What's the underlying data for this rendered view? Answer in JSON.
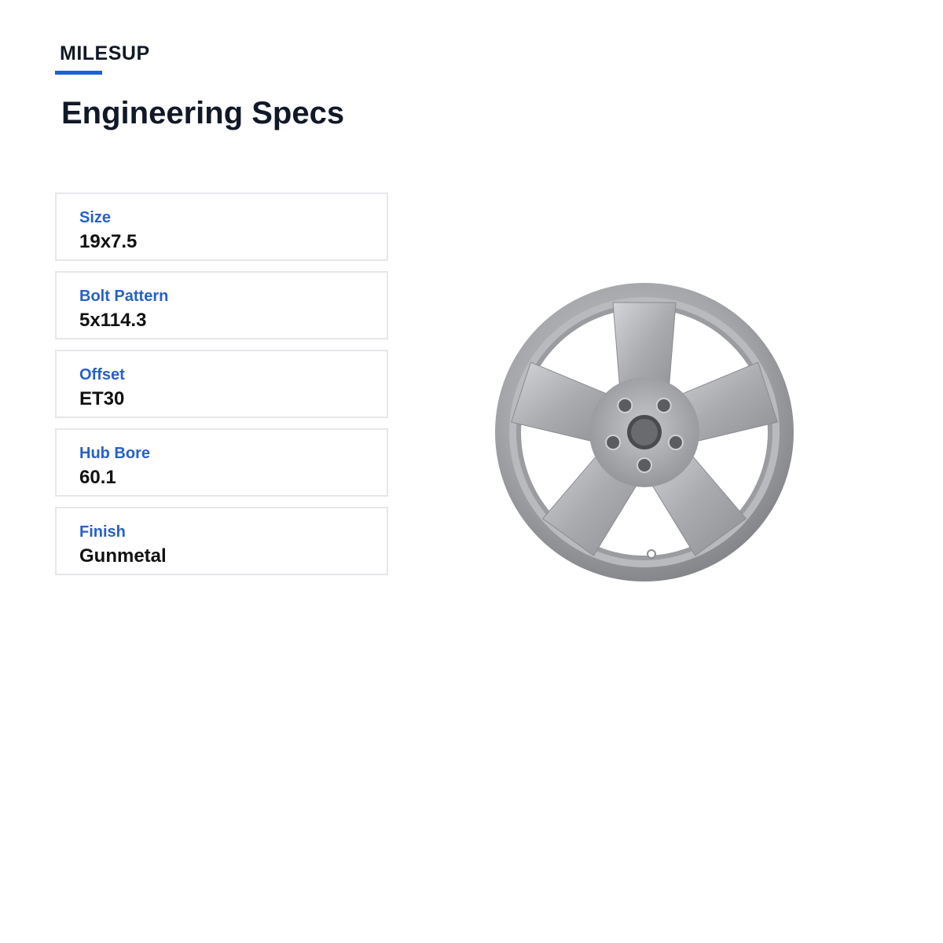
{
  "brand": {
    "name": "MILESUP",
    "accent_color": "#1d5fd6"
  },
  "page_title": "Engineering Specs",
  "specs": [
    {
      "label": "Size",
      "value": "19x7.5"
    },
    {
      "label": "Bolt Pattern",
      "value": "5x114.3"
    },
    {
      "label": "Offset",
      "value": "ET30"
    },
    {
      "label": "Hub Bore",
      "value": "60.1"
    },
    {
      "label": "Finish",
      "value": "Gunmetal"
    }
  ],
  "colors": {
    "label": "#2760c8",
    "value": "#111111",
    "title": "#111827",
    "card_border": "#e5e7eb"
  },
  "product_image": {
    "icon": "wheel-icon",
    "spokes": 5,
    "lug_holes": 5
  }
}
